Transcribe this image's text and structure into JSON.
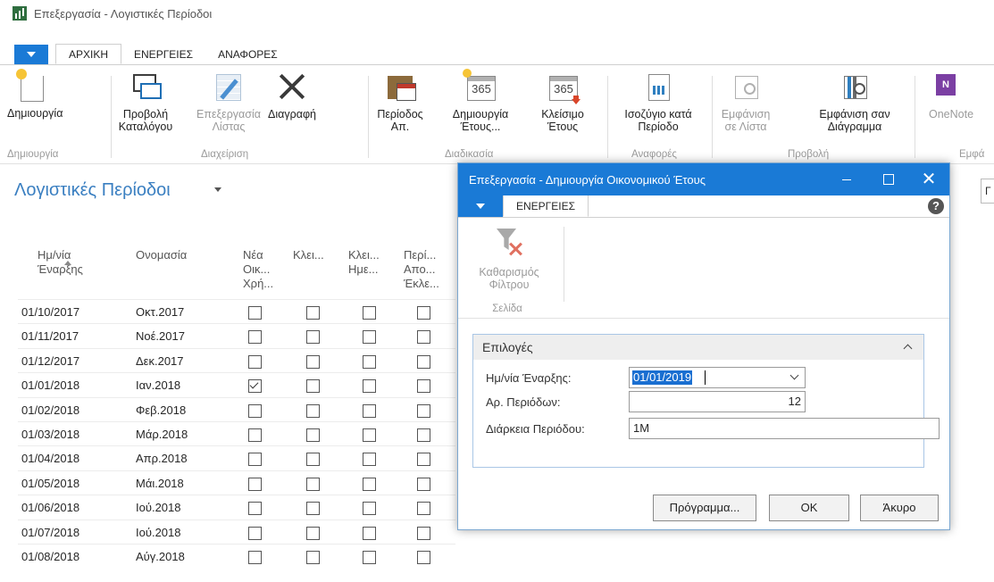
{
  "window": {
    "title": "Επεξεργασία - Λογιστικές Περίοδοι"
  },
  "tabs": [
    "ΑΡΧΙΚΗ",
    "ΕΝΕΡΓΕΙΕΣ",
    "ΑΝΑΦΟΡΕΣ"
  ],
  "ribbon": {
    "buttons": {
      "new": "Δημιουργία",
      "view_list_1": "Προβολή",
      "view_list_2": "Καταλόγου",
      "edit_list_1": "Επεξεργασία",
      "edit_list_2": "Λίστας",
      "delete": "Διαγραφή",
      "period_1": "Περίοδος",
      "period_2": "Απ.",
      "create_year_1": "Δημιουργία",
      "create_year_2": "Έτους...",
      "close_year_1": "Κλείσιμο",
      "close_year_2": "Έτους",
      "trial_1": "Ισοζύγιο κατά",
      "trial_2": "Περίοδο",
      "show_list_1": "Εμφάνιση",
      "show_list_2": "σε Λίστα",
      "show_chart_1": "Εμφάνιση σαν",
      "show_chart_2": "Διάγραμμα",
      "onenote": "OneNote"
    },
    "groups": {
      "new": "Δημιουργία",
      "manage": "Διαχείριση",
      "process": "Διαδικασία",
      "reports": "Αναφορές",
      "view": "Προβολή",
      "show": "Εμφά"
    }
  },
  "page": {
    "title": "Λογιστικές Περίοδοι",
    "right_edge": "Γ"
  },
  "list": {
    "headers": {
      "start_1": "Ημ/νία",
      "start_2": "Έναρξης",
      "name": "Ονομασία",
      "newyear_1": "Νέα",
      "newyear_2": "Οικ...",
      "newyear_3": "Χρή...",
      "closed": "Κλει...",
      "closedate_1": "Κλει...",
      "closedate_2": "Ημε...",
      "period_1": "Περί...",
      "period_2": "Απο...",
      "period_3": "Έκλε..."
    },
    "rows": [
      {
        "date": "01/10/2017",
        "name": "Οκτ.2017",
        "new_year": false
      },
      {
        "date": "01/11/2017",
        "name": "Νοέ.2017",
        "new_year": false
      },
      {
        "date": "01/12/2017",
        "name": "Δεκ.2017",
        "new_year": false
      },
      {
        "date": "01/01/2018",
        "name": "Ιαν.2018",
        "new_year": true
      },
      {
        "date": "01/02/2018",
        "name": "Φεβ.2018",
        "new_year": false
      },
      {
        "date": "01/03/2018",
        "name": "Μάρ.2018",
        "new_year": false
      },
      {
        "date": "01/04/2018",
        "name": "Απρ.2018",
        "new_year": false
      },
      {
        "date": "01/05/2018",
        "name": "Μάι.2018",
        "new_year": false
      },
      {
        "date": "01/06/2018",
        "name": "Ιού.2018",
        "new_year": false
      },
      {
        "date": "01/07/2018",
        "name": "Ιού.2018",
        "new_year": false
      },
      {
        "date": "01/08/2018",
        "name": "Αύγ.2018",
        "new_year": false
      }
    ]
  },
  "dialog": {
    "title": "Επεξεργασία - Δημιουργία Οικονομικού Έτους",
    "tab": "ΕΝΕΡΓΕΙΕΣ",
    "help": "?",
    "clear_filter_1": "Καθαρισμός",
    "clear_filter_2": "Φίλτρου",
    "group": "Σελίδα",
    "section": "Επιλογές",
    "fields": {
      "start_label": "Ημ/νία Έναρξης:",
      "start_value": "01/01/2019",
      "count_label": "Αρ. Περιόδων:",
      "count_value": "12",
      "length_label": "Διάρκεια Περιόδου:",
      "length_value": "1M"
    },
    "buttons": {
      "schedule": "Πρόγραμμα...",
      "ok": "OK",
      "cancel": "Άκυρο"
    },
    "close_glyph": "✕"
  }
}
